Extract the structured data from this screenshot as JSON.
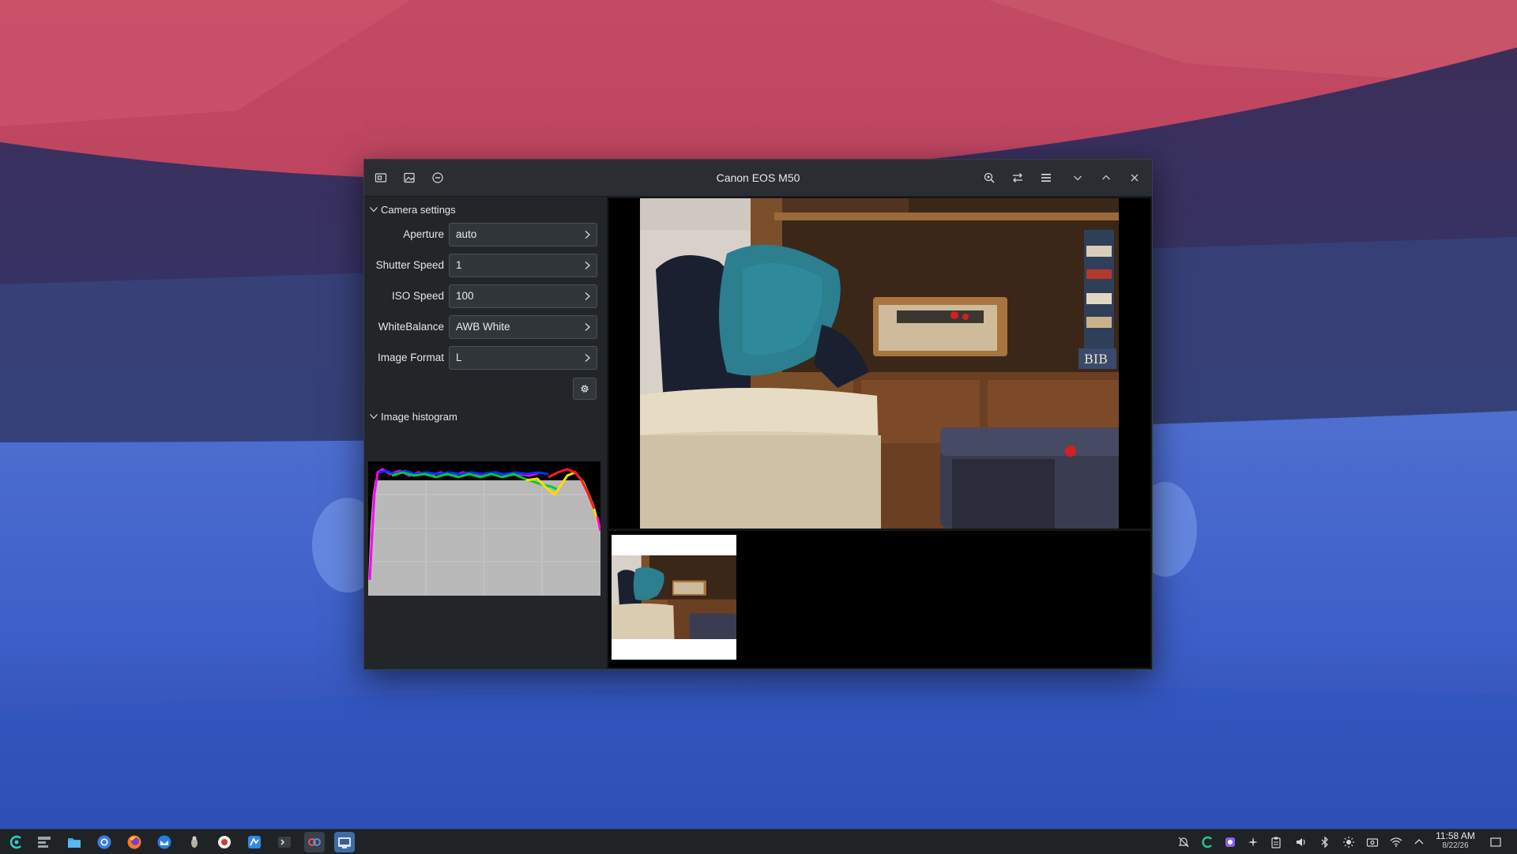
{
  "window": {
    "title": "Canon EOS M50"
  },
  "camera_settings": {
    "header": "Camera settings",
    "rows": [
      {
        "label": "Aperture",
        "value": "auto"
      },
      {
        "label": "Shutter Speed",
        "value": "1"
      },
      {
        "label": "ISO Speed",
        "value": "100"
      },
      {
        "label": "WhiteBalance",
        "value": "AWB White"
      },
      {
        "label": "Image Format",
        "value": "L"
      }
    ]
  },
  "histogram": {
    "header": "Image histogram"
  },
  "taskbar": {
    "clock_time": "11:58 AM",
    "clock_date": "8/22/26"
  },
  "icons": {
    "titlebar_left": [
      "capture-icon",
      "image-icon",
      "liveview-toggle-icon"
    ],
    "titlebar_right": [
      "zoom-icon",
      "adjust-icon",
      "hamburger-menu-icon",
      "minimize-icon",
      "maximize-icon",
      "close-icon"
    ],
    "taskbar_apps": [
      "app-launcher-icon",
      "task-manager-icon",
      "file-manager-icon",
      "chromium-icon",
      "firefox-icon",
      "thunderbird-icon",
      "app-icon",
      "app-icon",
      "app-icon",
      "terminal-icon",
      "app-icon",
      "camera-app-icon"
    ],
    "tray": [
      "notifications-icon",
      "app-icon",
      "app-icon",
      "app-icon",
      "clipboard-icon",
      "volume-icon",
      "bluetooth-icon",
      "brightness-icon",
      "display-icon",
      "wifi-icon",
      "chevron-up-icon",
      "show-desktop-icon"
    ]
  },
  "colors": {
    "window_bg": "#232629",
    "titlebar_bg": "#2a2e32",
    "field_bg": "#31363b",
    "histogram_bg": "#b7b7b7",
    "taskbar_bg": "#1f2326"
  }
}
